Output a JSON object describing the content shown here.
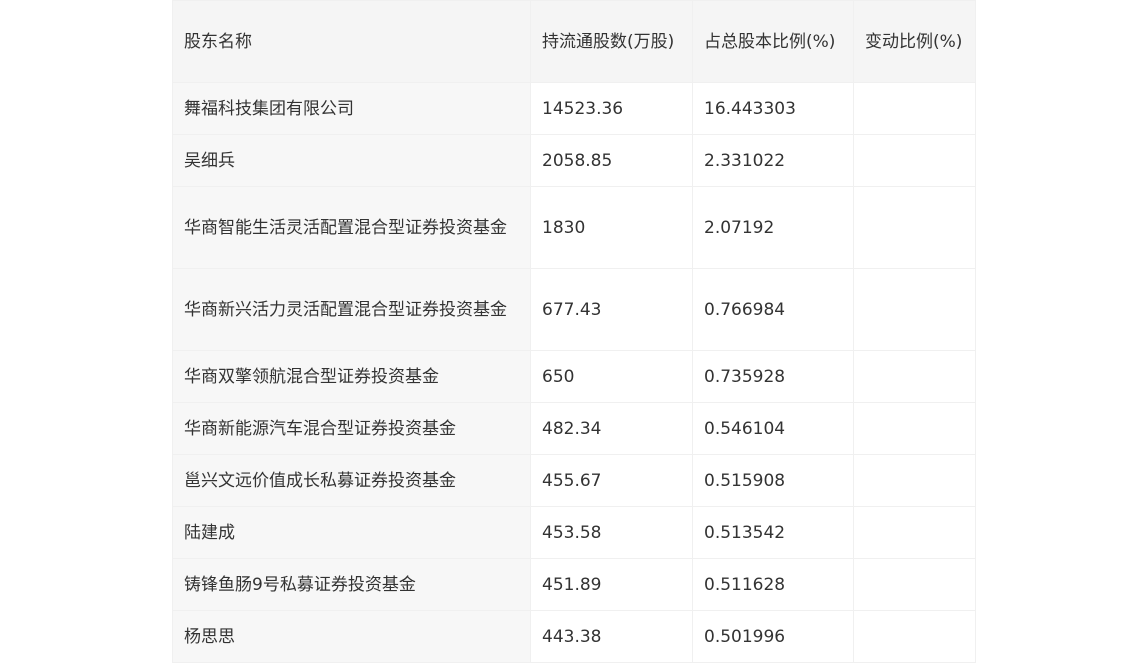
{
  "table": {
    "headers": [
      "股东名称",
      "持流通股数(万股)",
      "占总股本比例(%)",
      "变动比例(%)"
    ],
    "rows": [
      [
        "舞福科技集团有限公司",
        "14523.36",
        "16.443303",
        ""
      ],
      [
        "吴细兵",
        "2058.85",
        "2.331022",
        ""
      ],
      [
        "华商智能生活灵活配置混合型证券投资基金",
        "1830",
        "2.07192",
        ""
      ],
      [
        "华商新兴活力灵活配置混合型证券投资基金",
        "677.43",
        "0.766984",
        ""
      ],
      [
        "华商双擎领航混合型证券投资基金",
        "650",
        "0.735928",
        ""
      ],
      [
        "华商新能源汽车混合型证券投资基金",
        "482.34",
        "0.546104",
        ""
      ],
      [
        "邕兴文远价值成长私募证券投资基金",
        "455.67",
        "0.515908",
        ""
      ],
      [
        "陆建成",
        "453.58",
        "0.513542",
        ""
      ],
      [
        "铸锋鱼肠9号私募证券投资基金",
        "451.89",
        "0.511628",
        ""
      ],
      [
        "杨思思",
        "443.38",
        "0.501996",
        ""
      ]
    ]
  }
}
